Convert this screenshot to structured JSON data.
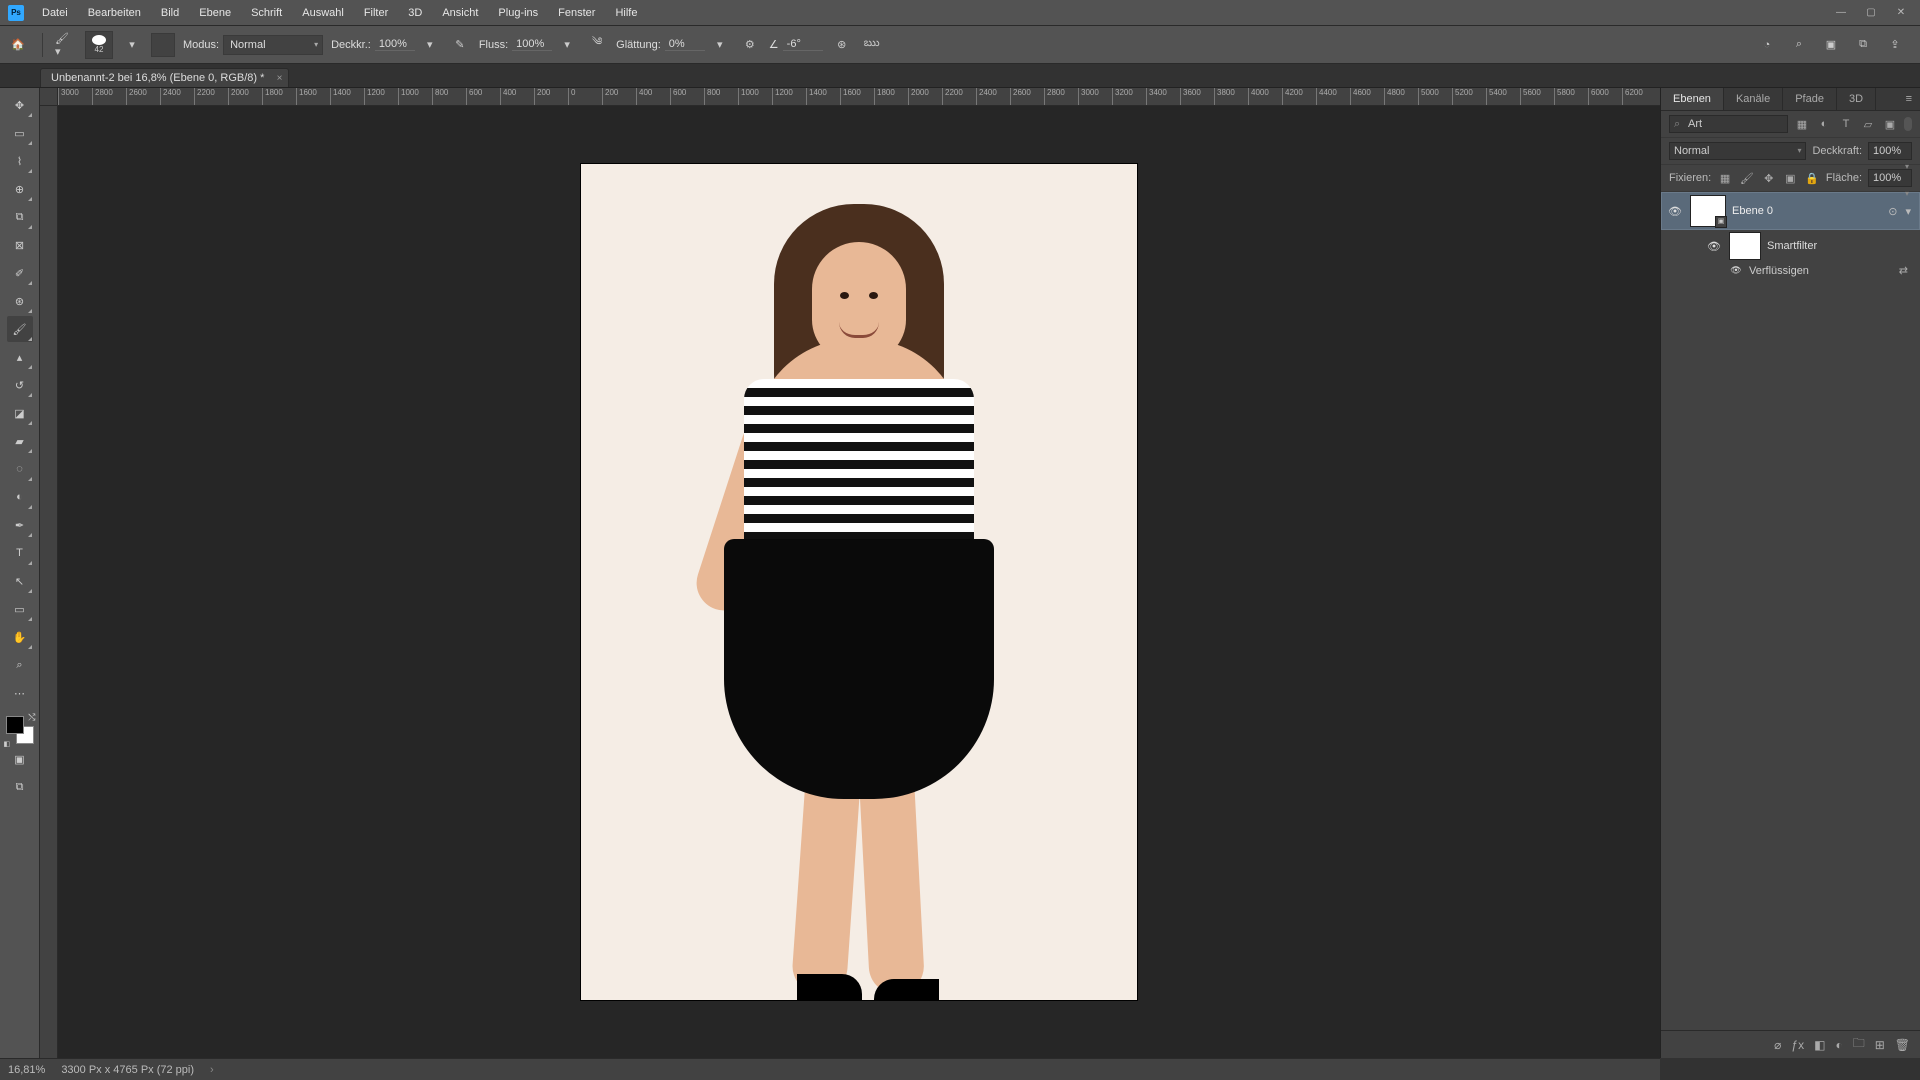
{
  "menu": {
    "items": [
      "Datei",
      "Bearbeiten",
      "Bild",
      "Ebene",
      "Schrift",
      "Auswahl",
      "Filter",
      "3D",
      "Ansicht",
      "Plug-ins",
      "Fenster",
      "Hilfe"
    ]
  },
  "window_controls": {
    "min": "—",
    "max": "▢",
    "close": "✕"
  },
  "options": {
    "brush_size": "42",
    "modus_label": "Modus:",
    "modus_value": "Normal",
    "deckkraft_label": "Deckkr.:",
    "deckkraft_value": "100%",
    "fluss_label": "Fluss:",
    "fluss_value": "100%",
    "glaettung_label": "Glättung:",
    "glaettung_value": "0%",
    "angle_icon": "∠",
    "angle_value": "-6°"
  },
  "doc_tab": {
    "title": "Unbenannt-2 bei 16,8% (Ebene 0, RGB/8) *"
  },
  "ruler_ticks": [
    "3000",
    "2800",
    "2600",
    "2400",
    "2200",
    "2000",
    "1800",
    "1600",
    "1400",
    "1200",
    "1000",
    "800",
    "600",
    "400",
    "200",
    "0",
    "200",
    "400",
    "600",
    "800",
    "1000",
    "1200",
    "1400",
    "1600",
    "1800",
    "2000",
    "2200",
    "2400",
    "2600",
    "2800",
    "3000",
    "3200",
    "3400",
    "3600",
    "3800",
    "4000",
    "4200",
    "4400",
    "4600",
    "4800",
    "5000",
    "5200",
    "5400",
    "5600",
    "5800",
    "6000",
    "6200"
  ],
  "panel": {
    "tabs": {
      "ebenen": "Ebenen",
      "kanaele": "Kanäle",
      "pfade": "Pfade",
      "threeD": "3D"
    },
    "search_label": "Art",
    "blend_mode": "Normal",
    "deckkraft_label": "Deckkraft:",
    "deckkraft_value": "100%",
    "fixieren_label": "Fixieren:",
    "flaeche_label": "Fläche:",
    "flaeche_value": "100%",
    "layer0_name": "Ebene 0",
    "smartfilter_label": "Smartfilter",
    "verfluessigen_label": "Verflüssigen"
  },
  "status": {
    "zoom": "16,81%",
    "dims": "3300 Px x 4765 Px (72 ppi)",
    "chev": "›"
  }
}
